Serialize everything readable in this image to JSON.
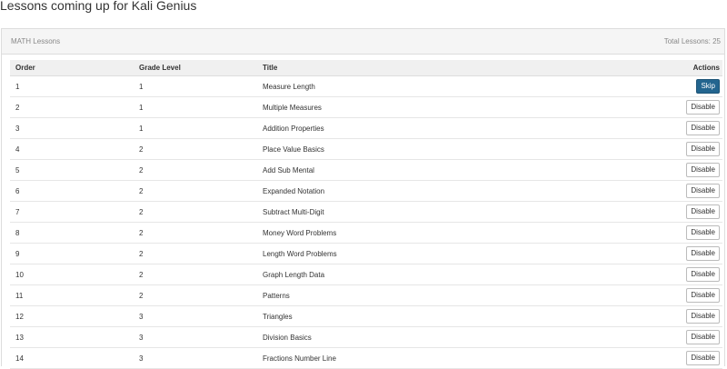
{
  "page": {
    "title": "Lessons coming up for Kali Genius"
  },
  "panel": {
    "title": "MATH Lessons",
    "total": "Total Lessons: 25"
  },
  "table": {
    "headers": {
      "order": "Order",
      "grade": "Grade Level",
      "title": "Title",
      "actions": "Actions"
    },
    "rows": [
      {
        "order": "1",
        "grade": "1",
        "title": "Measure Length",
        "action": "Skip"
      },
      {
        "order": "2",
        "grade": "1",
        "title": "Multiple Measures",
        "action": "Disable"
      },
      {
        "order": "3",
        "grade": "1",
        "title": "Addition Properties",
        "action": "Disable"
      },
      {
        "order": "4",
        "grade": "2",
        "title": "Place Value Basics",
        "action": "Disable"
      },
      {
        "order": "5",
        "grade": "2",
        "title": "Add Sub Mental",
        "action": "Disable"
      },
      {
        "order": "6",
        "grade": "2",
        "title": "Expanded Notation",
        "action": "Disable"
      },
      {
        "order": "7",
        "grade": "2",
        "title": "Subtract Multi-Digit",
        "action": "Disable"
      },
      {
        "order": "8",
        "grade": "2",
        "title": "Money Word Problems",
        "action": "Disable"
      },
      {
        "order": "9",
        "grade": "2",
        "title": "Length Word Problems",
        "action": "Disable"
      },
      {
        "order": "10",
        "grade": "2",
        "title": "Graph Length Data",
        "action": "Disable"
      },
      {
        "order": "11",
        "grade": "2",
        "title": "Patterns",
        "action": "Disable"
      },
      {
        "order": "12",
        "grade": "3",
        "title": "Triangles",
        "action": "Disable"
      },
      {
        "order": "13",
        "grade": "3",
        "title": "Division Basics",
        "action": "Disable"
      },
      {
        "order": "14",
        "grade": "3",
        "title": "Fractions Number Line",
        "action": "Disable"
      }
    ]
  },
  "colors": {
    "primary_button": "#23658f",
    "panel_heading_bg": "#f5f5f5",
    "table_header_bg": "#f0f0f0"
  }
}
